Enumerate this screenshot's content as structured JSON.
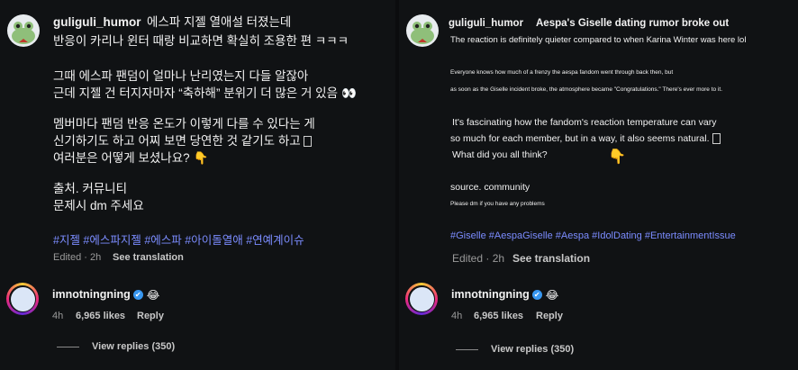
{
  "left": {
    "author": "guliguli_humor",
    "lines": [
      "에스파 지젤 열애설 터졌는데",
      "반응이 카리나 윈터 때랑 비교하면 확실히 조용한 편 ㅋㅋㅋ",
      "그때 에스파 팬덤이 얼마나 난리였는지 다들 알잖아",
      "근데 지젤 건 터지자마자 “축하해” 분위기 더 많은 거 있음",
      "멤버마다 팬덤 반응 온도가 이렇게 다를 수 있다는 게",
      "신기하기도 하고 어찌 보면 당연한 것 같기도 하고",
      "여러분은 어떻게 보셨나요?",
      "출처. 커뮤니티",
      "문제시 dm 주세요"
    ],
    "hashtags": "#지젤 #에스파지젤 #에스파 #아이돌열애 #연예계이슈",
    "edited": "Edited · 2h",
    "see_translation": "See translation",
    "reply_user": "imnotningning",
    "reply_time": "4h",
    "reply_likes": "6,965 likes",
    "reply_label": "Reply",
    "view_replies": "View replies (350)"
  },
  "right": {
    "author": "guliguli_humor",
    "title": "Aespa's Giselle dating rumor broke out",
    "line1": "The reaction is definitely quieter compared to when Karina Winter was here lol",
    "line2": "Everyone knows how much of a frenzy the aespa fandom went through back then, but",
    "line3": "as soon as the Giselle incident broke, the atmosphere became \"Congratulations.\" There's ever more to it.",
    "line4": "It's fascinating how the fandom's reaction temperature can vary",
    "line5": "so much for each member, but in a way, it also seems natural.",
    "line6": "What did you all think?",
    "source": "source. community",
    "dm": "Please dm if you have any problems",
    "hashtags": "#Giselle #AespaGiselle #Aespa #IdolDating #EntertainmentIssue",
    "edited": "Edited · 2h",
    "see_translation": "See translation",
    "reply_user": "imnotningning",
    "reply_time": "4h",
    "reply_likes": "6,965 likes",
    "reply_label": "Reply",
    "view_replies": "View replies (350)"
  },
  "icons": {
    "eyes": "👀",
    "hand": "👇",
    "laugh": "😂",
    "check": "✔"
  }
}
